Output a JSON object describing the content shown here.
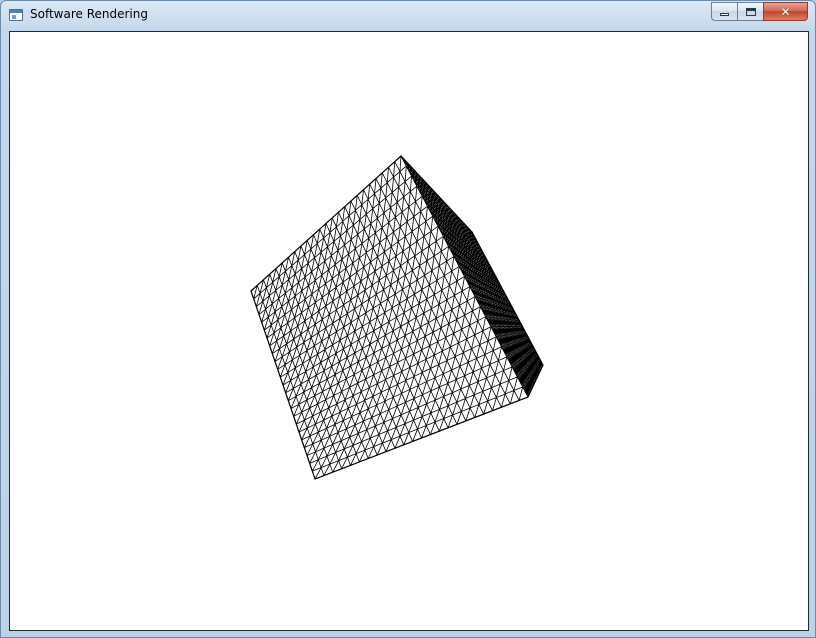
{
  "window": {
    "title": "Software Rendering",
    "icon": "application-window-icon",
    "controls": {
      "minimize": "minimize-icon",
      "maximize": "maximize-icon",
      "close": "close-icon",
      "close_glyph": "✕"
    }
  },
  "viewport": {
    "content": "wireframe-cube",
    "background_color": "#ffffff",
    "line_color": "#000000",
    "grid_divisions": 24
  },
  "colors": {
    "frame": "#bcd2e8",
    "close_button": "#c94a34"
  }
}
